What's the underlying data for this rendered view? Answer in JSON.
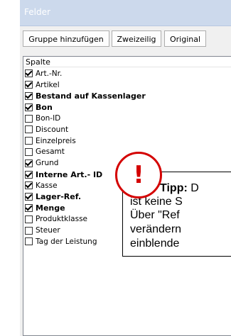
{
  "panel": {
    "title": "Felder"
  },
  "toolbar": {
    "add_group_label": "Gruppe hinzufügen",
    "two_line_label": "Zweizeilig",
    "original_label": "Original"
  },
  "list": {
    "column_header": "Spalte",
    "items": [
      {
        "label": "Art.-Nr.",
        "checked": true,
        "bold": false
      },
      {
        "label": "Artikel",
        "checked": true,
        "bold": false
      },
      {
        "label": "Bestand auf Kassenlager",
        "checked": true,
        "bold": true
      },
      {
        "label": "Bon",
        "checked": true,
        "bold": true
      },
      {
        "label": "Bon-ID",
        "checked": false,
        "bold": false
      },
      {
        "label": "Discount",
        "checked": false,
        "bold": false
      },
      {
        "label": "Einzelpreis",
        "checked": false,
        "bold": false
      },
      {
        "label": "Gesamt",
        "checked": false,
        "bold": false
      },
      {
        "label": "Grund",
        "checked": true,
        "bold": false
      },
      {
        "label": "Interne Art.- ID",
        "checked": true,
        "bold": true
      },
      {
        "label": "Kasse",
        "checked": true,
        "bold": false
      },
      {
        "label": "Lager-Ref.",
        "checked": true,
        "bold": true
      },
      {
        "label": "Menge",
        "checked": true,
        "bold": true
      },
      {
        "label": "Produktklasse",
        "checked": false,
        "bold": false
      },
      {
        "label": "Steuer",
        "checked": false,
        "bold": false
      },
      {
        "label": "Tag der Leistung",
        "checked": false,
        "bold": false
      }
    ]
  },
  "tip": {
    "alert_symbol": "!",
    "heading": "Tipp:",
    "line1_rest": " D",
    "line2": "ist keine S",
    "line3": "Über \"Ref",
    "line4": "verändern",
    "line5": "einblende"
  },
  "colors": {
    "header_bg": "#ccd9ec",
    "alert_red": "#d40000"
  }
}
